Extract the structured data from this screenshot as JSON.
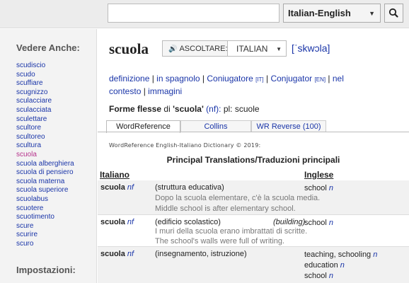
{
  "search": {
    "value": "",
    "placeholder": "",
    "dictionary": "Italian-English"
  },
  "sidebar": {
    "see_also_title": "Vedere Anche:",
    "items": [
      {
        "label": "scudiscio"
      },
      {
        "label": "scudo"
      },
      {
        "label": "scuffiare"
      },
      {
        "label": "scugnizzo"
      },
      {
        "label": "sculacciare"
      },
      {
        "label": "sculacciata"
      },
      {
        "label": "sculettare"
      },
      {
        "label": "scultore"
      },
      {
        "label": "scultoreo"
      },
      {
        "label": "scultura"
      },
      {
        "label": "scuola",
        "current": true
      },
      {
        "label": "scuola alberghiera"
      },
      {
        "label": "scuola di pensiero"
      },
      {
        "label": "scuola materna"
      },
      {
        "label": "scuola superiore"
      },
      {
        "label": "scuolabus"
      },
      {
        "label": "scuotere"
      },
      {
        "label": "scuotimento"
      },
      {
        "label": "scure"
      },
      {
        "label": "scurire"
      },
      {
        "label": "scuro"
      }
    ],
    "settings_title": "Impostazioni:"
  },
  "entry": {
    "headword": "scuola",
    "listen_label": "ASCOLTARE:",
    "accent": "ITALIAN",
    "ipa": "[ˈskwɔla]"
  },
  "links": {
    "definizione": "definizione",
    "spagnolo": "in spagnolo",
    "coniugatore": "Coniugatore",
    "coniugatore_tag": "[IT]",
    "conjugator": "Conjugator",
    "conjugator_tag": "[EN]",
    "contesto": "nel contesto",
    "immagini": "immagini"
  },
  "forms": {
    "label": "Forme flesse",
    "of": "di",
    "word": "'scuola'",
    "pos": "(nf):",
    "plural": "pl: scuole"
  },
  "tabs": [
    {
      "label": "WordReference"
    },
    {
      "label": "Collins"
    },
    {
      "label": "WR Reverse (100)"
    }
  ],
  "copyright": "WordReference English-Italiano Dictionary © 2019:",
  "section_title": "Principal Translations/Traduzioni principali",
  "columns": {
    "italian": "Italiano",
    "english": "Inglese"
  },
  "rows": [
    {
      "headword": "scuola",
      "pos": "nf",
      "context": "(struttura educativa)",
      "context2": "",
      "translations": [
        {
          "text": "school",
          "pos": "n"
        }
      ],
      "example_it": "Dopo la scuola elementare, c'è la scuola media.",
      "example_en": "Middle school is after elementary school."
    },
    {
      "headword": "scuola",
      "pos": "nf",
      "context": "(edificio scolastico)",
      "context2": "(building)",
      "translations": [
        {
          "text": "school",
          "pos": "n"
        }
      ],
      "example_it": "I muri della scuola erano imbrattati di scritte.",
      "example_en": "The school's walls were full of writing."
    },
    {
      "headword": "scuola",
      "pos": "nf",
      "context": "(insegnamento, istruzione)",
      "context2": "",
      "translations": [
        {
          "text": "teaching, schooling",
          "pos": "n"
        },
        {
          "text": "education",
          "pos": "n"
        },
        {
          "text": "school",
          "pos": "n"
        }
      ]
    }
  ],
  "icons": {
    "search": "search-icon",
    "speaker": "speaker-icon",
    "caret": "chevron-down-icon"
  },
  "colors": {
    "link": "#1a35a8",
    "current": "#b5318b",
    "row_alt": "#f1f1f1"
  }
}
